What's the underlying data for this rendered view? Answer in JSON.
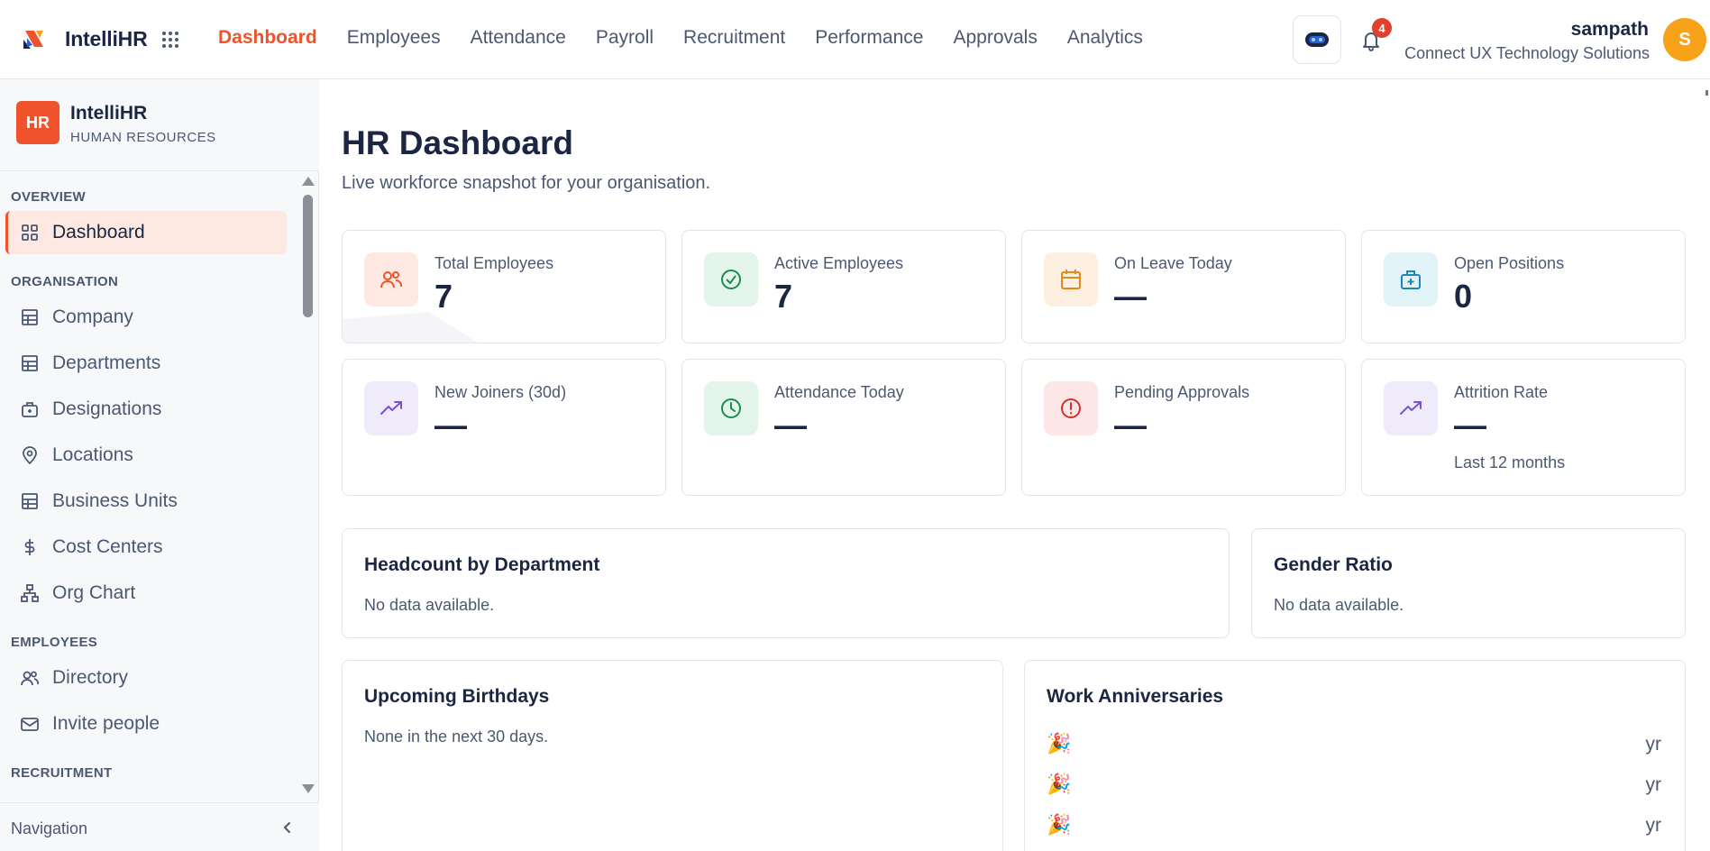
{
  "topbar": {
    "brand": "IntelliHR",
    "nav": [
      {
        "label": "Dashboard",
        "active": true
      },
      {
        "label": "Employees"
      },
      {
        "label": "Attendance"
      },
      {
        "label": "Payroll"
      },
      {
        "label": "Recruitment"
      },
      {
        "label": "Performance"
      },
      {
        "label": "Approvals"
      },
      {
        "label": "Analytics"
      }
    ],
    "notifications_count": "4",
    "user": {
      "name": "sampath",
      "org": "Connect UX Technology Solutions",
      "initial": "S"
    },
    "accent_color": "#f0532b"
  },
  "sidebar": {
    "logo_text": "HR",
    "title": "IntelliHR",
    "subtitle": "HUMAN RESOURCES",
    "sections": {
      "overview": "OVERVIEW",
      "organisation": "ORGANISATION",
      "employees": "EMPLOYEES",
      "recruitment": "RECRUITMENT"
    },
    "items": [
      {
        "label": "Dashboard",
        "icon": "grid-icon",
        "active": true
      },
      {
        "label": "Company",
        "icon": "building-icon"
      },
      {
        "label": "Departments",
        "icon": "building-icon"
      },
      {
        "label": "Designations",
        "icon": "briefcase-icon"
      },
      {
        "label": "Locations",
        "icon": "map-pin-icon"
      },
      {
        "label": "Business Units",
        "icon": "building-icon"
      },
      {
        "label": "Cost Centers",
        "icon": "dollar-icon"
      },
      {
        "label": "Org Chart",
        "icon": "org-chart-icon"
      },
      {
        "label": "Directory",
        "icon": "users-icon"
      },
      {
        "label": "Invite people",
        "icon": "mail-icon"
      }
    ],
    "footer_label": "Navigation"
  },
  "main": {
    "title": "HR Dashboard",
    "subtitle": "Live workforce snapshot for your organisation.",
    "stats": [
      {
        "label": "Total Employees",
        "value": "7",
        "icon": "users-icon"
      },
      {
        "label": "Active Employees",
        "value": "7",
        "icon": "check-circle-icon"
      },
      {
        "label": "On Leave Today",
        "value": "—",
        "icon": "calendar-icon"
      },
      {
        "label": "Open Positions",
        "value": "0",
        "icon": "briefcase-plus-icon"
      },
      {
        "label": "New Joiners (30d)",
        "value": "—",
        "icon": "trending-up-icon"
      },
      {
        "label": "Attendance Today",
        "value": "—",
        "icon": "clock-icon"
      },
      {
        "label": "Pending Approvals",
        "value": "—",
        "icon": "alert-circle-icon"
      },
      {
        "label": "Attrition Rate",
        "value": "—",
        "note": "Last 12 months",
        "icon": "trending-up-icon"
      }
    ],
    "headcount": {
      "title": "Headcount by Department",
      "empty": "No data available."
    },
    "gender": {
      "title": "Gender Ratio",
      "empty": "No data available."
    },
    "birthdays": {
      "title": "Upcoming Birthdays",
      "empty": "None in the next 30 days."
    },
    "anniversaries": {
      "title": "Work Anniversaries",
      "rows": [
        {
          "emoji": "🎉",
          "suffix": "yr"
        },
        {
          "emoji": "🎉",
          "suffix": "yr"
        },
        {
          "emoji": "🎉",
          "suffix": "yr"
        }
      ]
    }
  }
}
